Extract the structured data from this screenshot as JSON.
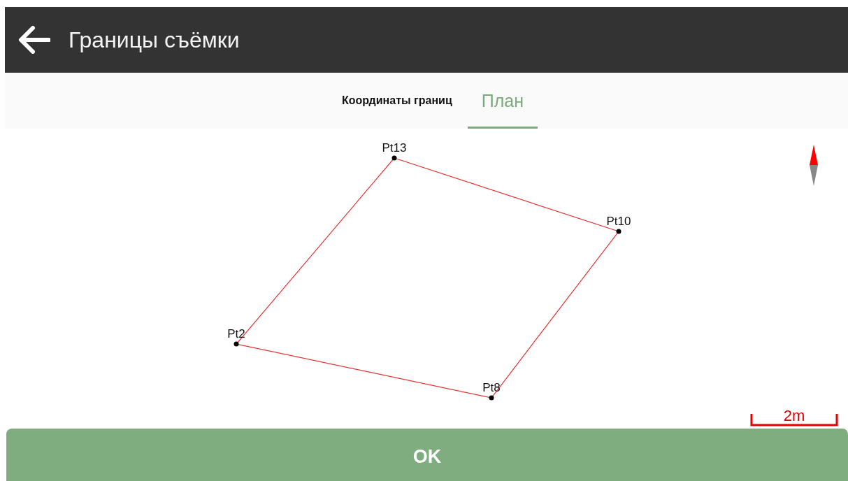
{
  "app_bar": {
    "title": "Границы съёмки"
  },
  "tabs": [
    {
      "label": "Координаты границ",
      "selected": false
    },
    {
      "label": "План",
      "selected": true
    }
  ],
  "plan": {
    "points": [
      {
        "name": "Pt13"
      },
      {
        "name": "Pt10"
      },
      {
        "name": "Pt8"
      },
      {
        "name": "Pt2"
      }
    ],
    "scale": "2m"
  },
  "ok_button": "OK"
}
